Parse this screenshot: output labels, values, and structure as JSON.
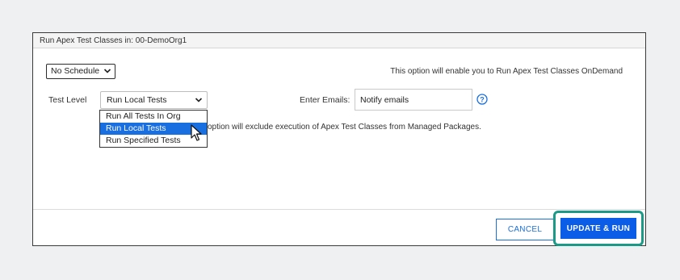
{
  "dialog": {
    "title": "Run Apex Test Classes in: 00-DemoOrg1"
  },
  "schedule": {
    "selected": "No Schedule"
  },
  "info_text": "This option will enable you to Run Apex Test Classes OnDemand",
  "test_level": {
    "label": "Test Level",
    "selected": "Run Local Tests",
    "options": [
      "Run All Tests In Org",
      "Run Local Tests",
      "Run Specified Tests"
    ],
    "highlighted_index": 1
  },
  "emails": {
    "label": "Enter Emails:",
    "value": "Notify emails"
  },
  "note_text": "option will exclude execution of Apex Test Classes from Managed Packages.",
  "buttons": {
    "cancel": "CANCEL",
    "update_run": "UPDATE & RUN"
  },
  "colors": {
    "accent": "#0b5ce6",
    "highlight_border": "#1a9a87"
  }
}
